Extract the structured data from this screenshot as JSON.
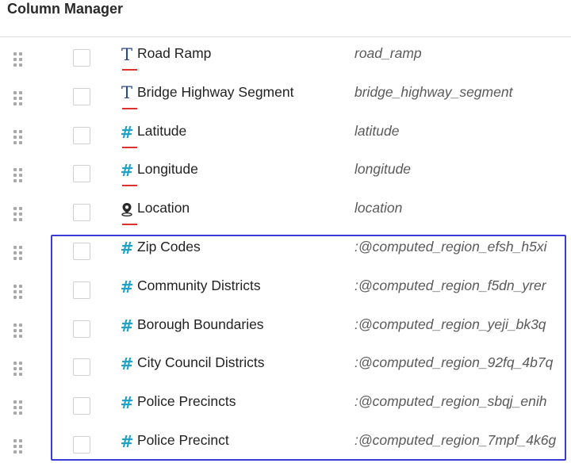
{
  "header": {
    "title": "Column Manager"
  },
  "columns": [
    {
      "label": "Road Ramp",
      "field": "road_ramp",
      "type_icon": "text-type-icon",
      "flagged": true
    },
    {
      "label": "Bridge Highway Segment",
      "field": "bridge_highway_segment",
      "type_icon": "text-type-icon",
      "flagged": true
    },
    {
      "label": "Latitude",
      "field": "latitude",
      "type_icon": "number-type-icon",
      "flagged": true
    },
    {
      "label": "Longitude",
      "field": "longitude",
      "type_icon": "number-type-icon",
      "flagged": true
    },
    {
      "label": "Location",
      "field": "location",
      "type_icon": "location-type-icon",
      "flagged": true
    },
    {
      "label": "Zip Codes",
      "field": ":@computed_region_efsh_h5xi",
      "type_icon": "number-type-icon",
      "flagged": false
    },
    {
      "label": "Community Districts",
      "field": ":@computed_region_f5dn_yrer",
      "type_icon": "number-type-icon",
      "flagged": false
    },
    {
      "label": "Borough Boundaries",
      "field": ":@computed_region_yeji_bk3q",
      "type_icon": "number-type-icon",
      "flagged": false
    },
    {
      "label": "City Council Districts",
      "field": ":@computed_region_92fq_4b7q",
      "type_icon": "number-type-icon",
      "flagged": false
    },
    {
      "label": "Police Precincts",
      "field": ":@computed_region_sbqj_enih",
      "type_icon": "number-type-icon",
      "flagged": false
    },
    {
      "label": "Police Precinct",
      "field": ":@computed_region_7mpf_4k6g",
      "type_icon": "number-type-icon",
      "flagged": false
    }
  ],
  "colors": {
    "text_type": "#2d4a87",
    "number_type": "#1ea2c8",
    "error_underline": "#d9332b",
    "highlight_border": "#3a3ad6"
  }
}
